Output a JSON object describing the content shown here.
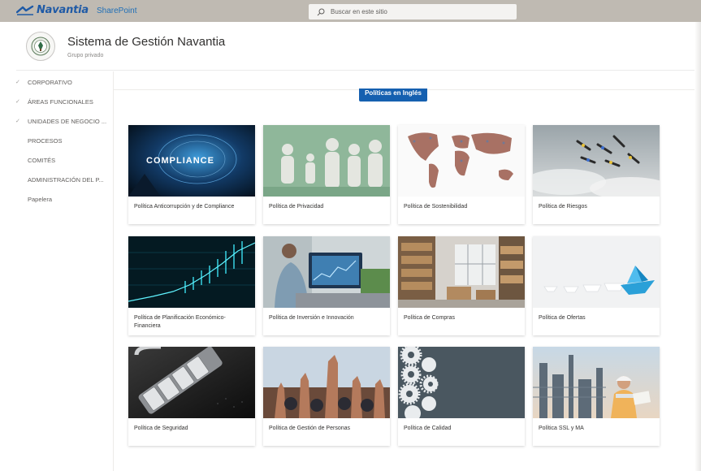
{
  "topbar": {
    "brand": "Navantia",
    "app": "SharePoint",
    "search_placeholder": "Buscar en este sitio"
  },
  "site": {
    "title": "Sistema de Gestión Navantia",
    "subtitle": "Grupo privado"
  },
  "nav": {
    "items": [
      {
        "label": "CORPORATIVO",
        "expandable": true
      },
      {
        "label": "ÁREAS FUNCIONALES",
        "expandable": true
      },
      {
        "label": "UNIDADES DE NEGOCIO ...",
        "expandable": true
      },
      {
        "label": "PROCESOS",
        "expandable": false
      },
      {
        "label": "COMITÉS",
        "expandable": false
      },
      {
        "label": "ADMINISTRACIÓN DEL P...",
        "expandable": false
      },
      {
        "label": "Papelera",
        "expandable": false
      }
    ]
  },
  "button_ingles": "Políticas en Inglés",
  "cards": [
    {
      "title": "Política Anticorrupción y de Compliance",
      "image": "compliance-image"
    },
    {
      "title": "Política de Privacidad",
      "image": "paper-figures-image"
    },
    {
      "title": "Política de Sostenibilidad",
      "image": "world-map-people-image"
    },
    {
      "title": "Política de Riesgos",
      "image": "skydivers-image"
    },
    {
      "title": "Política de Planificación Económico-Financiera",
      "image": "financial-chart-image"
    },
    {
      "title": "Política de Inversión e Innovación",
      "image": "analyst-monitor-image"
    },
    {
      "title": "Política de Compras",
      "image": "warehouse-image"
    },
    {
      "title": "Política de Ofertas",
      "image": "paper-boats-image"
    },
    {
      "title": "Política de Seguridad",
      "image": "combination-lock-image"
    },
    {
      "title": "Política de Gestión de Personas",
      "image": "raised-hands-image"
    },
    {
      "title": "Política de Calidad",
      "image": "gears-image"
    },
    {
      "title": "Política SSL y MA",
      "image": "industrial-worker-image"
    }
  ],
  "colors": {
    "topbar": "#bfbab2",
    "brand": "#1f5aa6",
    "button": "#1560b0"
  }
}
